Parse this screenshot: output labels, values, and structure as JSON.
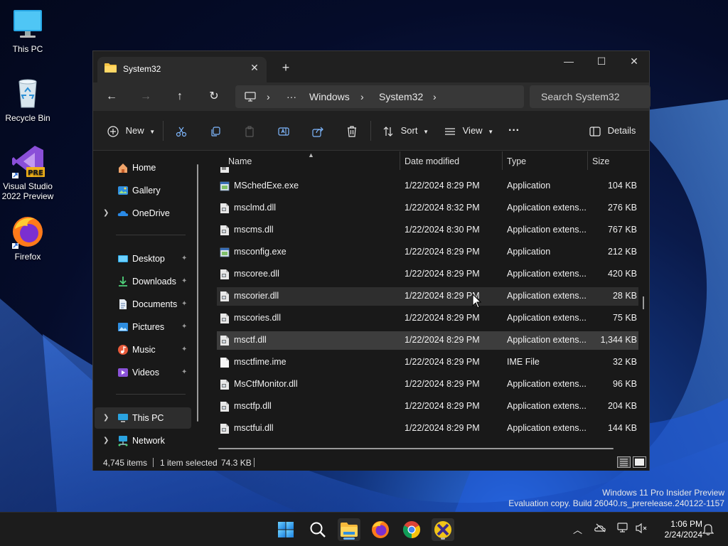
{
  "desktop": {
    "icons": [
      {
        "label": "This PC",
        "icon": "monitor-icon"
      },
      {
        "label": "Recycle Bin",
        "icon": "recycle-bin-icon"
      },
      {
        "label": "Visual Studio 2022 Preview",
        "line1": "Visual Studio",
        "line2": "2022 Preview",
        "badge": "PRE",
        "icon": "visual-studio-icon"
      },
      {
        "label": "Firefox",
        "icon": "firefox-icon"
      }
    ],
    "watermark": {
      "line1": "Windows 11 Pro Insider Preview",
      "line2": "Evaluation copy. Build 26040.rs_prerelease.240122-1157"
    }
  },
  "window": {
    "tab_title": "System32",
    "tab_close": "✕",
    "new_tab": "+",
    "controls": {
      "minimize": "—",
      "maximize": "☐",
      "close": "✕"
    },
    "nav": {
      "back": "←",
      "forward": "→",
      "up": "↑",
      "refresh": "↻"
    },
    "address": {
      "more": "···",
      "segments": [
        "Windows",
        "System32"
      ],
      "sep": "›"
    },
    "search_placeholder": "Search System32",
    "commands": {
      "new_label": "New",
      "sort_label": "Sort",
      "view_label": "View",
      "more_label": "···",
      "details_label": "Details"
    },
    "sidebar": {
      "items": [
        {
          "label": "Home",
          "icon": "home-icon"
        },
        {
          "label": "Gallery",
          "icon": "gallery-icon"
        },
        {
          "label": "OneDrive",
          "icon": "onedrive-icon",
          "expandable": true
        },
        {
          "label": "Desktop",
          "icon": "desktop-icon",
          "pinned": true
        },
        {
          "label": "Downloads",
          "icon": "downloads-icon",
          "pinned": true
        },
        {
          "label": "Documents",
          "icon": "documents-icon",
          "pinned": true
        },
        {
          "label": "Pictures",
          "icon": "pictures-icon",
          "pinned": true
        },
        {
          "label": "Music",
          "icon": "music-icon",
          "pinned": true
        },
        {
          "label": "Videos",
          "icon": "videos-icon",
          "pinned": true
        },
        {
          "label": "This PC",
          "icon": "this-pc-icon",
          "expandable": true,
          "selected": true
        },
        {
          "label": "Network",
          "icon": "network-icon",
          "expandable": true
        }
      ],
      "chevron": "❯",
      "pin": "📌"
    },
    "columns": {
      "name": "Name",
      "date": "Date modified",
      "type": "Type",
      "size": "Size"
    },
    "files": [
      {
        "name": "MSchedExe.exe",
        "date": "1/22/2024 8:29 PM",
        "type": "Application",
        "size": "104 KB",
        "icon": "exe-icon"
      },
      {
        "name": "msclmd.dll",
        "date": "1/22/2024 8:32 PM",
        "type": "Application extens...",
        "size": "276 KB",
        "icon": "dll-icon"
      },
      {
        "name": "mscms.dll",
        "date": "1/22/2024 8:30 PM",
        "type": "Application extens...",
        "size": "767 KB",
        "icon": "dll-icon"
      },
      {
        "name": "msconfig.exe",
        "date": "1/22/2024 8:29 PM",
        "type": "Application",
        "size": "212 KB",
        "icon": "exe-icon"
      },
      {
        "name": "mscoree.dll",
        "date": "1/22/2024 8:29 PM",
        "type": "Application extens...",
        "size": "420 KB",
        "icon": "dll-icon"
      },
      {
        "name": "mscorier.dll",
        "date": "1/22/2024 8:29 PM",
        "type": "Application extens...",
        "size": "28 KB",
        "icon": "dll-icon",
        "state": "hover"
      },
      {
        "name": "mscories.dll",
        "date": "1/22/2024 8:29 PM",
        "type": "Application extens...",
        "size": "75 KB",
        "icon": "dll-icon"
      },
      {
        "name": "msctf.dll",
        "date": "1/22/2024 8:29 PM",
        "type": "Application extens...",
        "size": "1,344 KB",
        "icon": "dll-icon",
        "state": "selected"
      },
      {
        "name": "msctfime.ime",
        "date": "1/22/2024 8:29 PM",
        "type": "IME File",
        "size": "32 KB",
        "icon": "ime-icon"
      },
      {
        "name": "MsCtfMonitor.dll",
        "date": "1/22/2024 8:29 PM",
        "type": "Application extens...",
        "size": "96 KB",
        "icon": "dll-icon"
      },
      {
        "name": "msctfp.dll",
        "date": "1/22/2024 8:29 PM",
        "type": "Application extens...",
        "size": "204 KB",
        "icon": "dll-icon"
      },
      {
        "name": "msctfui.dll",
        "date": "1/22/2024 8:29 PM",
        "type": "Application extens...",
        "size": "144 KB",
        "icon": "dll-icon"
      }
    ],
    "status": {
      "count": "4,745 items",
      "selected": "1 item selected",
      "size": "74.3 KB"
    }
  },
  "taskbar": {
    "apps": [
      "start-icon",
      "search-icon",
      "file-explorer-icon",
      "firefox-icon",
      "chrome-icon",
      "xming-icon"
    ],
    "clock_time": "1:06 PM",
    "clock_date": "2/24/2024"
  },
  "colors": {
    "accent": "#4cc2ff",
    "folder": "#f6c445",
    "window_bg": "#191919",
    "selected_row": "#3d3d3d"
  }
}
